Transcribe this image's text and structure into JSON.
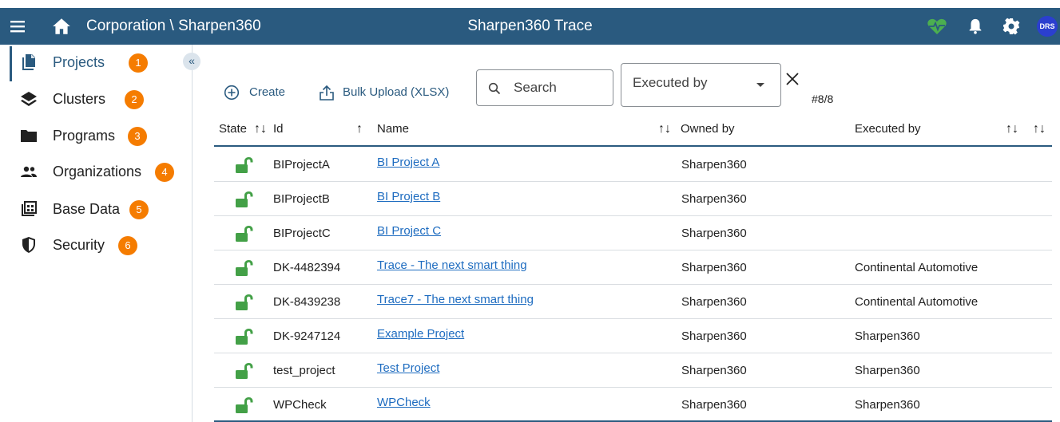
{
  "header": {
    "breadcrumb": "Corporation \\ Sharpen360",
    "app_title": "Sharpen360 Trace",
    "avatar_initials": "DRS",
    "bar_color": "#2a5a7f",
    "health_icon_color": "#4caf50"
  },
  "sidebar": {
    "items": [
      {
        "label": "Projects",
        "badge": "1",
        "icon": "projects-icon",
        "active": true
      },
      {
        "label": "Clusters",
        "badge": "2",
        "icon": "layers-icon"
      },
      {
        "label": "Programs",
        "badge": "3",
        "icon": "folder-icon"
      },
      {
        "label": "Organizations",
        "badge": "4",
        "icon": "people-icon"
      },
      {
        "label": "Base Data",
        "badge": "5",
        "icon": "base-data-icon"
      },
      {
        "label": "Security",
        "badge": "6",
        "icon": "shield-icon"
      }
    ],
    "collapse_label": "«",
    "badge_color": "#f57c00"
  },
  "toolbar": {
    "create_label": "Create",
    "bulk_upload_label": "Bulk Upload (XLSX)",
    "search_placeholder": "Search",
    "executed_by_select": "Executed by",
    "result_count": "#8/8"
  },
  "table": {
    "headers": {
      "state": "State",
      "id": "Id",
      "name": "Name",
      "owned_by": "Owned by",
      "executed_by": "Executed by"
    },
    "rows": [
      {
        "id": "BIProjectA",
        "name": "BI Project A",
        "owned_by": "Sharpen360",
        "executed_by": ""
      },
      {
        "id": "BIProjectB",
        "name": "BI Project B",
        "owned_by": "Sharpen360",
        "executed_by": ""
      },
      {
        "id": "BIProjectC",
        "name": "BI Project C",
        "owned_by": "Sharpen360",
        "executed_by": ""
      },
      {
        "id": "DK-4482394",
        "name": "Trace - The next smart thing",
        "owned_by": "Sharpen360",
        "executed_by": "Continental Automotive"
      },
      {
        "id": "DK-8439238",
        "name": "Trace7 - The next smart thing",
        "owned_by": "Sharpen360",
        "executed_by": "Continental Automotive"
      },
      {
        "id": "DK-9247124",
        "name": "Example Project",
        "owned_by": "Sharpen360",
        "executed_by": "Sharpen360"
      },
      {
        "id": "test_project",
        "name": "Test Project",
        "owned_by": "Sharpen360",
        "executed_by": "Sharpen360"
      },
      {
        "id": "WPCheck",
        "name": "WPCheck",
        "owned_by": "Sharpen360",
        "executed_by": "Sharpen360"
      }
    ],
    "lock_color": "#43a047",
    "link_color": "#1e6cc0"
  }
}
